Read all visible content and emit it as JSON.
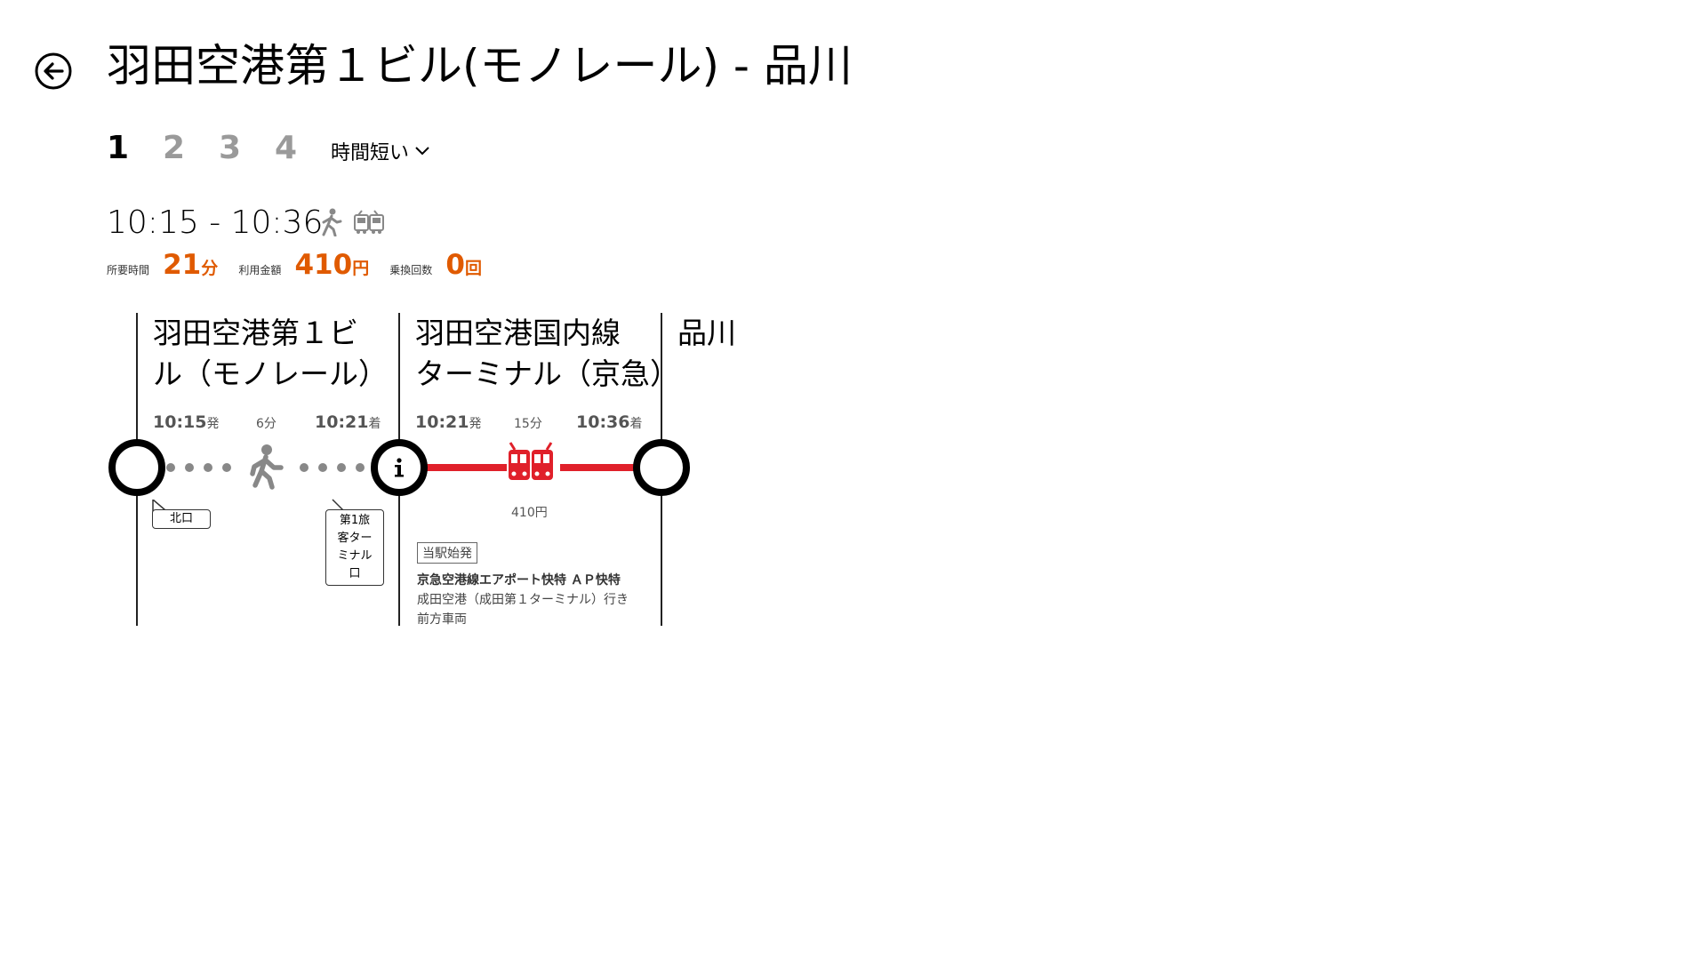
{
  "header": {
    "title": "羽田空港第１ビル(モノレール) - 品川"
  },
  "route_tabs": [
    {
      "label": "1",
      "active": true
    },
    {
      "label": "2",
      "active": false
    },
    {
      "label": "3",
      "active": false
    },
    {
      "label": "4",
      "active": false
    }
  ],
  "sort": {
    "label": "時間短い"
  },
  "summary": {
    "time_range": "10:15 - 10:36",
    "icons": [
      "walk-icon",
      "train-icon"
    ],
    "duration_label": "所要時間",
    "duration_value": "21",
    "duration_unit": "分",
    "fare_label": "利用金額",
    "fare_value": "410",
    "fare_unit": "円",
    "transfers_label": "乗換回数",
    "transfers_value": "0",
    "transfers_unit": "回"
  },
  "stations": [
    {
      "name_line1": "羽田空港第１ビ",
      "name_line2": "ル（モノレール）"
    },
    {
      "name_line1": "羽田空港国内線",
      "name_line2": "ターミナル（京急）"
    },
    {
      "name_line1": "品川",
      "name_line2": ""
    }
  ],
  "segments": [
    {
      "mode": "walk",
      "depart_time": "10:15",
      "depart_suffix": "発",
      "duration": "6分",
      "arrive_time": "10:21",
      "arrive_suffix": "着",
      "exit_label": "北口",
      "entrance_label": [
        "第1旅",
        "客ター",
        "ミナル",
        "口"
      ]
    },
    {
      "mode": "train",
      "depart_time": "10:21",
      "depart_suffix": "発",
      "duration": "15分",
      "arrive_time": "10:36",
      "arrive_suffix": "着",
      "fare": "410円",
      "badge": "当駅始発",
      "line_name": "京急空港線エアポート快特 ＡＰ快特",
      "destination": "成田空港（成田第１ターミナル）行き",
      "car_position": "前方車両"
    }
  ],
  "colors": {
    "accent_orange": "#e05a00",
    "train_red": "#e0202a",
    "walk_gray": "#888888"
  }
}
